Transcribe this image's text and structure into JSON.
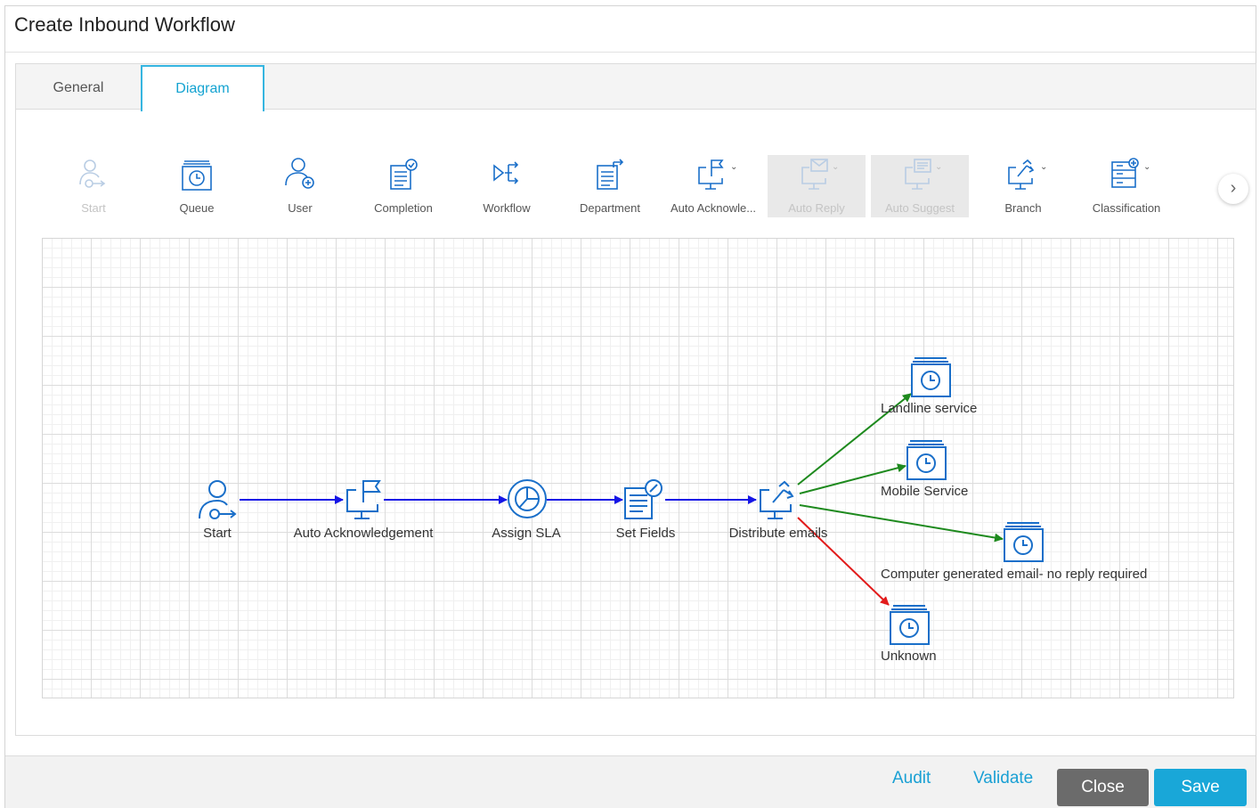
{
  "dialog": {
    "title": "Create Inbound Workflow"
  },
  "tabs": [
    {
      "label": "General",
      "active": false
    },
    {
      "label": "Diagram",
      "active": true
    }
  ],
  "toolbar": {
    "items": [
      {
        "label": "Start",
        "icon": "start-icon",
        "disabled": true
      },
      {
        "label": "Queue",
        "icon": "queue-icon",
        "disabled": false
      },
      {
        "label": "User",
        "icon": "user-icon",
        "disabled": false
      },
      {
        "label": "Completion",
        "icon": "completion-icon",
        "disabled": false
      },
      {
        "label": "Workflow",
        "icon": "workflow-icon",
        "disabled": false
      },
      {
        "label": "Department",
        "icon": "department-icon",
        "disabled": false
      },
      {
        "label": "Auto Acknowle...",
        "icon": "auto-acknowledgement-icon",
        "disabled": false,
        "dropdown": true
      },
      {
        "label": "Auto Reply",
        "icon": "auto-reply-icon",
        "disabled": true,
        "dropdown": true
      },
      {
        "label": "Auto Suggest",
        "icon": "auto-suggest-icon",
        "disabled": true,
        "dropdown": true
      },
      {
        "label": "Branch",
        "icon": "branch-icon",
        "disabled": false,
        "dropdown": true
      },
      {
        "label": "Classification",
        "icon": "classification-icon",
        "disabled": false,
        "dropdown": true
      }
    ],
    "next_icon": "chevron-right-icon"
  },
  "diagram": {
    "nodes": [
      {
        "id": "start",
        "label": "Start",
        "icon": "start-icon"
      },
      {
        "id": "auto_ack",
        "label": "Auto Acknowledgement",
        "icon": "auto-acknowledgement-icon"
      },
      {
        "id": "sla",
        "label": "Assign SLA",
        "icon": "sla-icon"
      },
      {
        "id": "set_fields",
        "label": "Set Fields",
        "icon": "set-fields-icon"
      },
      {
        "id": "distribute",
        "label": "Distribute emails",
        "icon": "branch-icon"
      },
      {
        "id": "landline",
        "label": "Landline service",
        "icon": "queue-icon"
      },
      {
        "id": "mobile",
        "label": "Mobile Service",
        "icon": "queue-icon"
      },
      {
        "id": "computer",
        "label": "Computer generated email- no reply required",
        "icon": "queue-icon"
      },
      {
        "id": "unknown",
        "label": "Unknown",
        "icon": "queue-icon"
      }
    ],
    "edges": [
      {
        "from": "start",
        "to": "auto_ack",
        "color": "#1515e6"
      },
      {
        "from": "auto_ack",
        "to": "sla",
        "color": "#1515e6"
      },
      {
        "from": "sla",
        "to": "set_fields",
        "color": "#1515e6"
      },
      {
        "from": "set_fields",
        "to": "distribute",
        "color": "#1515e6"
      },
      {
        "from": "distribute",
        "to": "landline",
        "color": "#1e8a1e"
      },
      {
        "from": "distribute",
        "to": "mobile",
        "color": "#1e8a1e"
      },
      {
        "from": "distribute",
        "to": "computer",
        "color": "#1e8a1e"
      },
      {
        "from": "distribute",
        "to": "unknown",
        "color": "#e21b1b"
      }
    ]
  },
  "footer": {
    "audit_label": "Audit",
    "validate_label": "Validate",
    "close_label": "Close",
    "save_label": "Save"
  },
  "colors": {
    "accent": "#1aa0d4",
    "icon": "#1a6fc9",
    "icon_disabled": "#b9cde4",
    "edge_main": "#1515e6",
    "edge_branch": "#1e8a1e",
    "edge_default": "#e21b1b",
    "close_button": "#6b6b6b",
    "save_button": "#19a7d8"
  }
}
